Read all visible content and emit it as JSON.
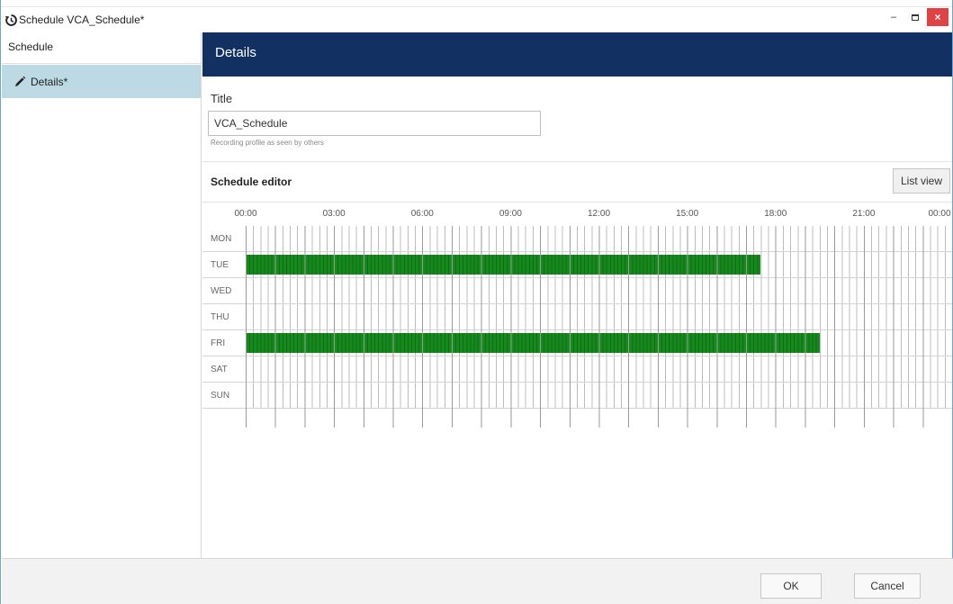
{
  "window": {
    "title": "Schedule VCA_Schedule*",
    "app_icon": "refresh-clock-icon",
    "controls": {
      "minimize": "–",
      "close": "×"
    }
  },
  "sidebar": {
    "header": "Schedule",
    "items": [
      {
        "label": "Details*",
        "icon": "pencil-icon"
      }
    ]
  },
  "details": {
    "header": "Details",
    "title_label": "Title",
    "title_value": "VCA_Schedule",
    "title_hint": "Recording profile as seen by others"
  },
  "schedule_editor": {
    "title": "Schedule editor",
    "list_view_label": "List view",
    "hours": [
      "00:00",
      "03:00",
      "06:00",
      "09:00",
      "12:00",
      "15:00",
      "18:00",
      "21:00",
      "00:00"
    ],
    "days": [
      {
        "label": "MON",
        "active": null
      },
      {
        "label": "TUE",
        "active": {
          "start": "00:00",
          "end": "17:30"
        }
      },
      {
        "label": "WED",
        "active": null
      },
      {
        "label": "THU",
        "active": null
      },
      {
        "label": "FRI",
        "active": {
          "start": "00:00",
          "end": "19:30"
        }
      },
      {
        "label": "SAT",
        "active": null
      },
      {
        "label": "SUN",
        "active": null
      }
    ],
    "active_color": "#16891c",
    "header_color": "#123162",
    "selected_item_color": "#bdd9e3"
  },
  "footer": {
    "ok_label": "OK",
    "cancel_label": "Cancel"
  }
}
